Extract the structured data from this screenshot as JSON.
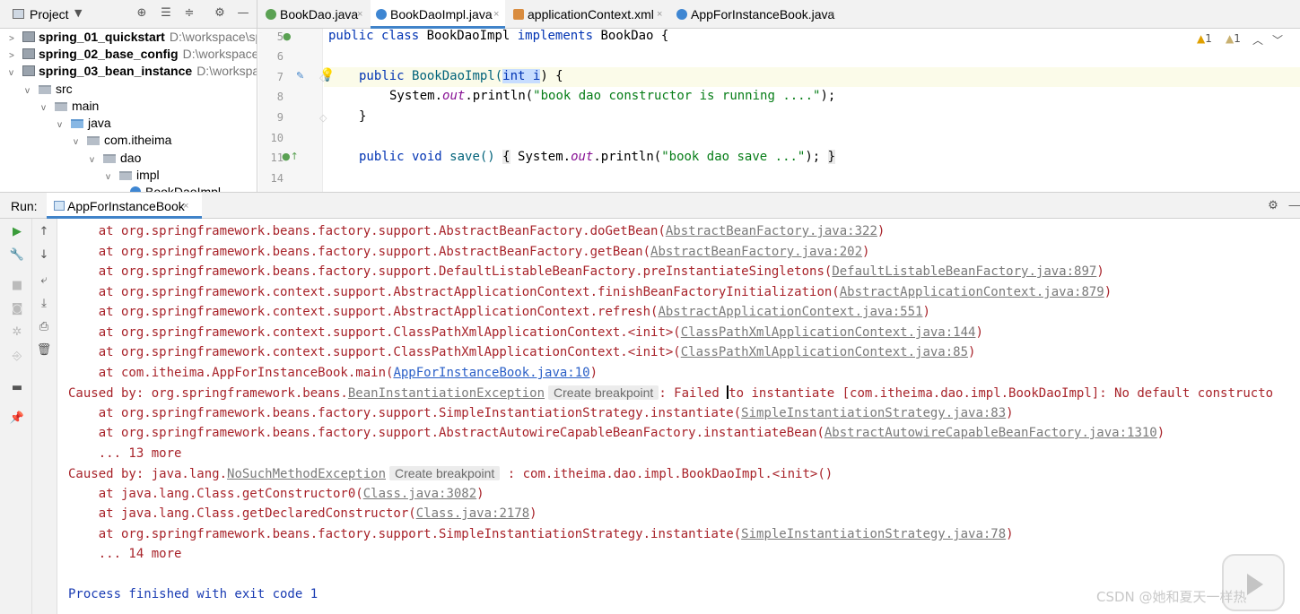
{
  "project_panel": {
    "label": "Project"
  },
  "tabs": [
    {
      "label": "BookDao.java",
      "icon": "interface-icon",
      "color": "#5aa153"
    },
    {
      "label": "BookDaoImpl.java",
      "icon": "class-icon",
      "color": "#3e86d2"
    },
    {
      "label": "applicationContext.xml",
      "icon": "xml-icon",
      "color": "#d98c3f"
    },
    {
      "label": "AppForInstanceBook.java",
      "icon": "class-icon",
      "color": "#3e86d2"
    }
  ],
  "tree": [
    {
      "label": "spring_01_quickstart",
      "path": "D:\\workspace\\sp"
    },
    {
      "label": "spring_02_base_config",
      "path": "D:\\workspace\\s"
    },
    {
      "label": "spring_03_bean_instance",
      "path": "D:\\workspace"
    },
    {
      "label": "src"
    },
    {
      "label": "main"
    },
    {
      "label": "java"
    },
    {
      "label": "com.itheima"
    },
    {
      "label": "dao"
    },
    {
      "label": "impl"
    },
    {
      "label": "BookDaoImpl"
    }
  ],
  "editor": {
    "line_numbers": [
      "5",
      "6",
      "7",
      "8",
      "9",
      "10",
      "11",
      "14"
    ],
    "warnings": {
      "a": "1",
      "b": "1"
    },
    "line5": {
      "kw1": "public class",
      "name": "BookDaoImpl",
      "kw2": "implements",
      "rest": "BookDao {"
    },
    "line7": {
      "kw": "public",
      "name": "BookDaoImpl(",
      "param": "int i",
      "rest": ") {"
    },
    "line8": {
      "pre": "System.",
      "out": "out",
      "mid": ".println(",
      "str": "\"book dao constructor is running ....\"",
      "post": ");"
    },
    "line9": {
      "text": "}"
    },
    "line11": {
      "kw": "public void",
      "name": "save()",
      "b1": "{",
      "mid": "System.",
      "out": "out",
      "mid2": ".println(",
      "str": "\"book dao save ...\"",
      "post": ");",
      "b2": "}"
    }
  },
  "run": {
    "label": "Run:",
    "tab": "AppForInstanceBook"
  },
  "console": {
    "lines": [
      {
        "pre": "    at org.springframework.beans.factory.support.AbstractBeanFactory.doGetBean(",
        "link": "AbstractBeanFactory.java:322",
        "post": ")"
      },
      {
        "pre": "    at org.springframework.beans.factory.support.AbstractBeanFactory.getBean(",
        "link": "AbstractBeanFactory.java:202",
        "post": ")"
      },
      {
        "pre": "    at org.springframework.beans.factory.support.DefaultListableBeanFactory.preInstantiateSingletons(",
        "link": "DefaultListableBeanFactory.java:897",
        "post": ")"
      },
      {
        "pre": "    at org.springframework.context.support.AbstractApplicationContext.finishBeanFactoryInitialization(",
        "link": "AbstractApplicationContext.java:879",
        "post": ")"
      },
      {
        "pre": "    at org.springframework.context.support.AbstractApplicationContext.refresh(",
        "link": "AbstractApplicationContext.java:551",
        "post": ")"
      },
      {
        "pre": "    at org.springframework.context.support.ClassPathXmlApplicationContext.<init>(",
        "link": "ClassPathXmlApplicationContext.java:144",
        "post": ")"
      },
      {
        "pre": "    at org.springframework.context.support.ClassPathXmlApplicationContext.<init>(",
        "link": "ClassPathXmlApplicationContext.java:85",
        "post": ")"
      },
      {
        "pre": "    at com.itheima.AppForInstanceBook.main(",
        "link": "AppForInstanceBook.java:10",
        "post": ")"
      }
    ],
    "caused1": {
      "pre": "Caused by: org.springframework.beans.",
      "exc": "BeanInstantiationException",
      "hint": "Create breakpoint",
      "sep": ": Failed ",
      "post": "to instantiate [com.itheima.dao.impl.BookDaoImpl]: No default constructo"
    },
    "lines2": [
      {
        "pre": "    at org.springframework.beans.factory.support.SimpleInstantiationStrategy.instantiate(",
        "link": "SimpleInstantiationStrategy.java:83",
        "post": ")"
      },
      {
        "pre": "    at org.springframework.beans.factory.support.AbstractAutowireCapableBeanFactory.instantiateBean(",
        "link": "AbstractAutowireCapableBeanFactory.java:1310",
        "post": ")"
      }
    ],
    "more1": "    ... 13 more",
    "caused2": {
      "pre": "Caused by: java.lang.",
      "exc": "NoSuchMethodException",
      "hint": "Create breakpoint",
      "post": " : com.itheima.dao.impl.BookDaoImpl.<init>()"
    },
    "lines3": [
      {
        "pre": "    at java.lang.Class.getConstructor0(",
        "link": "Class.java:3082",
        "post": ")"
      },
      {
        "pre": "    at java.lang.Class.getDeclaredConstructor(",
        "link": "Class.java:2178",
        "post": ")"
      },
      {
        "pre": "    at org.springframework.beans.factory.support.SimpleInstantiationStrategy.instantiate(",
        "link": "SimpleInstantiationStrategy.java:78",
        "post": ")"
      }
    ],
    "more2": "    ... 14 more",
    "finished": "Process finished with exit code 1"
  },
  "watermark": "CSDN @她和夏天一样热"
}
